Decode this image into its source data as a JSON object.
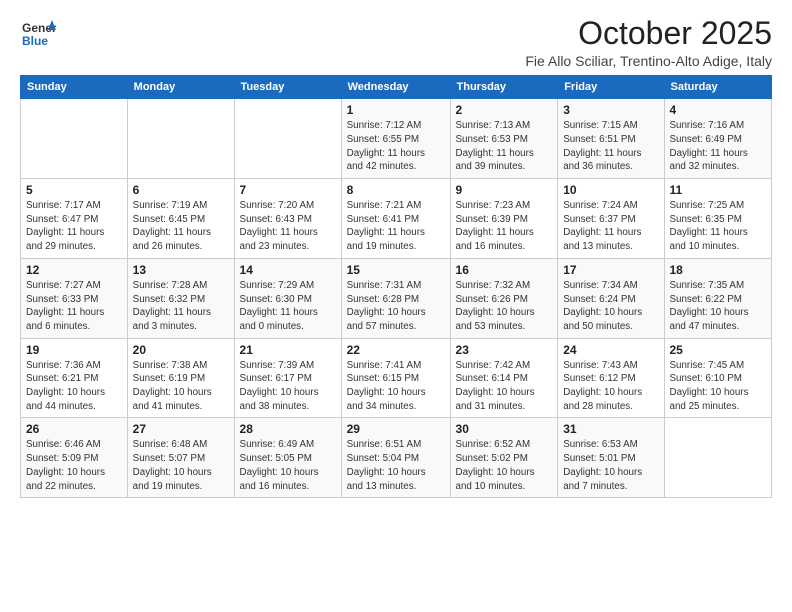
{
  "logo": {
    "general": "General",
    "blue": "Blue"
  },
  "title": "October 2025",
  "location": "Fie Allo Sciliar, Trentino-Alto Adige, Italy",
  "weekdays": [
    "Sunday",
    "Monday",
    "Tuesday",
    "Wednesday",
    "Thursday",
    "Friday",
    "Saturday"
  ],
  "weeks": [
    [
      {
        "day": "",
        "info": ""
      },
      {
        "day": "",
        "info": ""
      },
      {
        "day": "",
        "info": ""
      },
      {
        "day": "1",
        "info": "Sunrise: 7:12 AM\nSunset: 6:55 PM\nDaylight: 11 hours\nand 42 minutes."
      },
      {
        "day": "2",
        "info": "Sunrise: 7:13 AM\nSunset: 6:53 PM\nDaylight: 11 hours\nand 39 minutes."
      },
      {
        "day": "3",
        "info": "Sunrise: 7:15 AM\nSunset: 6:51 PM\nDaylight: 11 hours\nand 36 minutes."
      },
      {
        "day": "4",
        "info": "Sunrise: 7:16 AM\nSunset: 6:49 PM\nDaylight: 11 hours\nand 32 minutes."
      }
    ],
    [
      {
        "day": "5",
        "info": "Sunrise: 7:17 AM\nSunset: 6:47 PM\nDaylight: 11 hours\nand 29 minutes."
      },
      {
        "day": "6",
        "info": "Sunrise: 7:19 AM\nSunset: 6:45 PM\nDaylight: 11 hours\nand 26 minutes."
      },
      {
        "day": "7",
        "info": "Sunrise: 7:20 AM\nSunset: 6:43 PM\nDaylight: 11 hours\nand 23 minutes."
      },
      {
        "day": "8",
        "info": "Sunrise: 7:21 AM\nSunset: 6:41 PM\nDaylight: 11 hours\nand 19 minutes."
      },
      {
        "day": "9",
        "info": "Sunrise: 7:23 AM\nSunset: 6:39 PM\nDaylight: 11 hours\nand 16 minutes."
      },
      {
        "day": "10",
        "info": "Sunrise: 7:24 AM\nSunset: 6:37 PM\nDaylight: 11 hours\nand 13 minutes."
      },
      {
        "day": "11",
        "info": "Sunrise: 7:25 AM\nSunset: 6:35 PM\nDaylight: 11 hours\nand 10 minutes."
      }
    ],
    [
      {
        "day": "12",
        "info": "Sunrise: 7:27 AM\nSunset: 6:33 PM\nDaylight: 11 hours\nand 6 minutes."
      },
      {
        "day": "13",
        "info": "Sunrise: 7:28 AM\nSunset: 6:32 PM\nDaylight: 11 hours\nand 3 minutes."
      },
      {
        "day": "14",
        "info": "Sunrise: 7:29 AM\nSunset: 6:30 PM\nDaylight: 11 hours\nand 0 minutes."
      },
      {
        "day": "15",
        "info": "Sunrise: 7:31 AM\nSunset: 6:28 PM\nDaylight: 10 hours\nand 57 minutes."
      },
      {
        "day": "16",
        "info": "Sunrise: 7:32 AM\nSunset: 6:26 PM\nDaylight: 10 hours\nand 53 minutes."
      },
      {
        "day": "17",
        "info": "Sunrise: 7:34 AM\nSunset: 6:24 PM\nDaylight: 10 hours\nand 50 minutes."
      },
      {
        "day": "18",
        "info": "Sunrise: 7:35 AM\nSunset: 6:22 PM\nDaylight: 10 hours\nand 47 minutes."
      }
    ],
    [
      {
        "day": "19",
        "info": "Sunrise: 7:36 AM\nSunset: 6:21 PM\nDaylight: 10 hours\nand 44 minutes."
      },
      {
        "day": "20",
        "info": "Sunrise: 7:38 AM\nSunset: 6:19 PM\nDaylight: 10 hours\nand 41 minutes."
      },
      {
        "day": "21",
        "info": "Sunrise: 7:39 AM\nSunset: 6:17 PM\nDaylight: 10 hours\nand 38 minutes."
      },
      {
        "day": "22",
        "info": "Sunrise: 7:41 AM\nSunset: 6:15 PM\nDaylight: 10 hours\nand 34 minutes."
      },
      {
        "day": "23",
        "info": "Sunrise: 7:42 AM\nSunset: 6:14 PM\nDaylight: 10 hours\nand 31 minutes."
      },
      {
        "day": "24",
        "info": "Sunrise: 7:43 AM\nSunset: 6:12 PM\nDaylight: 10 hours\nand 28 minutes."
      },
      {
        "day": "25",
        "info": "Sunrise: 7:45 AM\nSunset: 6:10 PM\nDaylight: 10 hours\nand 25 minutes."
      }
    ],
    [
      {
        "day": "26",
        "info": "Sunrise: 6:46 AM\nSunset: 5:09 PM\nDaylight: 10 hours\nand 22 minutes."
      },
      {
        "day": "27",
        "info": "Sunrise: 6:48 AM\nSunset: 5:07 PM\nDaylight: 10 hours\nand 19 minutes."
      },
      {
        "day": "28",
        "info": "Sunrise: 6:49 AM\nSunset: 5:05 PM\nDaylight: 10 hours\nand 16 minutes."
      },
      {
        "day": "29",
        "info": "Sunrise: 6:51 AM\nSunset: 5:04 PM\nDaylight: 10 hours\nand 13 minutes."
      },
      {
        "day": "30",
        "info": "Sunrise: 6:52 AM\nSunset: 5:02 PM\nDaylight: 10 hours\nand 10 minutes."
      },
      {
        "day": "31",
        "info": "Sunrise: 6:53 AM\nSunset: 5:01 PM\nDaylight: 10 hours\nand 7 minutes."
      },
      {
        "day": "",
        "info": ""
      }
    ]
  ]
}
